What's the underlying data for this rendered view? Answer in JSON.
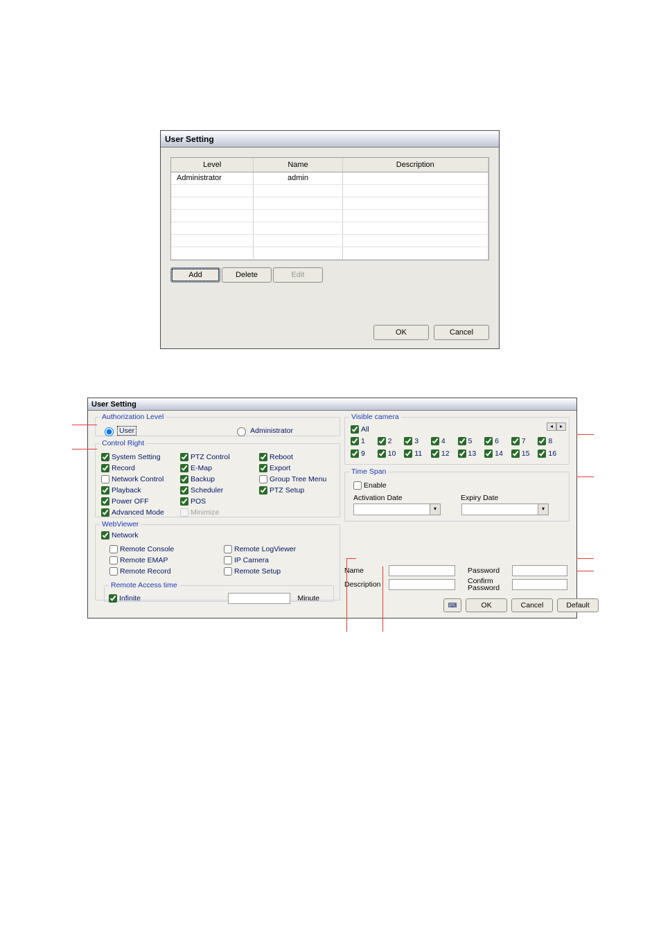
{
  "dialog1": {
    "title": "User Setting",
    "columns": {
      "level": "Level",
      "name": "Name",
      "desc": "Description"
    },
    "rows": [
      {
        "level": "Administrator",
        "name": "admin",
        "desc": ""
      },
      {
        "level": "",
        "name": "",
        "desc": ""
      },
      {
        "level": "",
        "name": "",
        "desc": ""
      },
      {
        "level": "",
        "name": "",
        "desc": ""
      },
      {
        "level": "",
        "name": "",
        "desc": ""
      },
      {
        "level": "",
        "name": "",
        "desc": ""
      },
      {
        "level": "",
        "name": "",
        "desc": ""
      }
    ],
    "buttons": {
      "add": "Add",
      "delete": "Delete",
      "edit": "Edit",
      "ok": "OK",
      "cancel": "Cancel"
    }
  },
  "dialog2": {
    "title": "User Setting",
    "groups": {
      "auth": "Authorization Level",
      "control": "Control Right",
      "web": "WebViewer",
      "rat": "Remote Access time",
      "cam": "Visible camera",
      "time": "Time Span"
    },
    "auth": {
      "user": "User",
      "admin": "Administrator",
      "selected": "user"
    },
    "control": {
      "col1": [
        {
          "label": "System Setting",
          "checked": true
        },
        {
          "label": "Record",
          "checked": true
        },
        {
          "label": "Network Control",
          "checked": false
        },
        {
          "label": "Playback",
          "checked": true
        },
        {
          "label": "Power OFF",
          "checked": true
        },
        {
          "label": "Advanced Mode",
          "checked": true
        }
      ],
      "col2": [
        {
          "label": "PTZ Control",
          "checked": true
        },
        {
          "label": "E-Map",
          "checked": true
        },
        {
          "label": "Backup",
          "checked": true
        },
        {
          "label": "Scheduler",
          "checked": true
        },
        {
          "label": "POS",
          "checked": true
        },
        {
          "label": "Minimize",
          "checked": false,
          "disabled": true
        }
      ],
      "col3": [
        {
          "label": "Reboot",
          "checked": true
        },
        {
          "label": "Export",
          "checked": true
        },
        {
          "label": "Group Tree Menu",
          "checked": false
        },
        {
          "label": "PTZ Setup",
          "checked": true
        }
      ]
    },
    "web": {
      "network": {
        "label": "Network",
        "checked": true
      },
      "col1": [
        {
          "label": "Remote Console",
          "checked": false
        },
        {
          "label": "Remote EMAP",
          "checked": false
        },
        {
          "label": "Remote Record",
          "checked": false
        }
      ],
      "col2": [
        {
          "label": "Remote LogViewer",
          "checked": false
        },
        {
          "label": "IP Camera",
          "checked": false
        },
        {
          "label": "Remote Setup",
          "checked": false
        }
      ]
    },
    "rat": {
      "infinite_label": "Infinite",
      "infinite_checked": true,
      "minute_value": "",
      "minute_unit": "Minute"
    },
    "cam": {
      "all_label": "All",
      "all_checked": true,
      "items": [
        {
          "n": "1",
          "c": true
        },
        {
          "n": "2",
          "c": true
        },
        {
          "n": "3",
          "c": true
        },
        {
          "n": "4",
          "c": true
        },
        {
          "n": "5",
          "c": true
        },
        {
          "n": "6",
          "c": true
        },
        {
          "n": "7",
          "c": true
        },
        {
          "n": "8",
          "c": true
        },
        {
          "n": "9",
          "c": true
        },
        {
          "n": "10",
          "c": true
        },
        {
          "n": "11",
          "c": true
        },
        {
          "n": "12",
          "c": true
        },
        {
          "n": "13",
          "c": true
        },
        {
          "n": "14",
          "c": true
        },
        {
          "n": "15",
          "c": true
        },
        {
          "n": "16",
          "c": true
        }
      ],
      "pager_prev": "◂",
      "pager_next": "▸"
    },
    "timespan": {
      "enable_label": "Enable",
      "enable_checked": false,
      "activation_label": "Activation Date",
      "expiry_label": "Expiry Date"
    },
    "form": {
      "name_label": "Name",
      "password_label": "Password",
      "description_label": "Description",
      "confirm_label_1": "Confirm",
      "confirm_label_2": "Password",
      "name_value": "",
      "password_value": "",
      "description_value": "",
      "confirm_value": ""
    },
    "footer": {
      "keyboard_icon": "⌨",
      "ok": "OK",
      "cancel": "Cancel",
      "default": "Default"
    }
  }
}
